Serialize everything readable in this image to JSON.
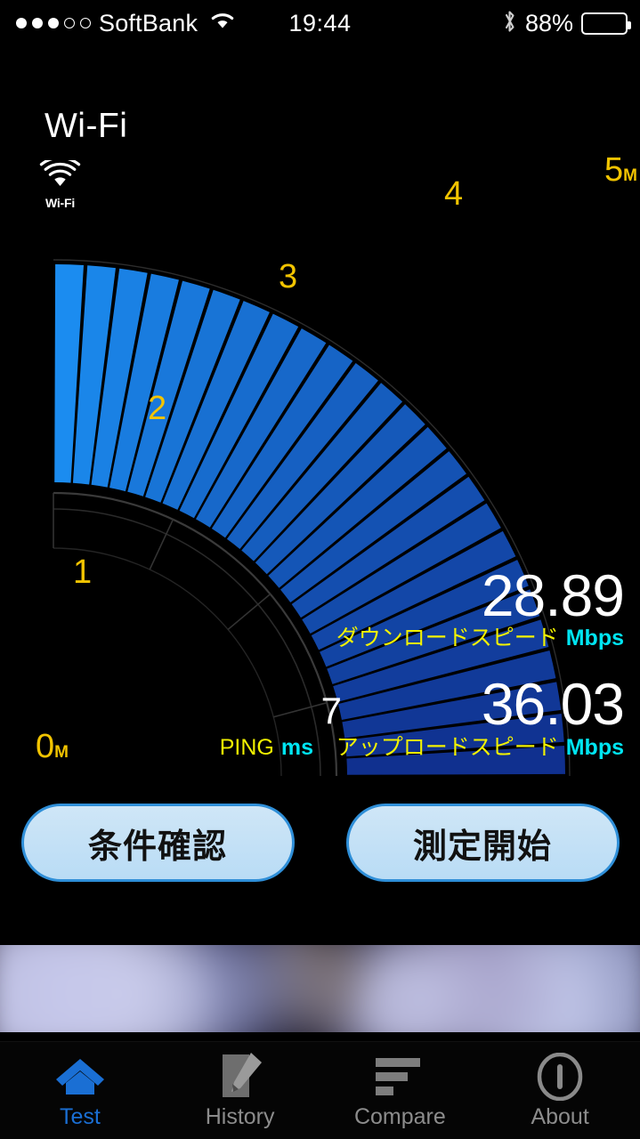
{
  "statusbar": {
    "signal_dots_filled": 3,
    "signal_dots_total": 5,
    "carrier": "SoftBank",
    "wifi_icon": "wifi-icon",
    "time": "19:44",
    "bluetooth_icon": "bluetooth-icon",
    "battery_percent": "88%",
    "battery_level": 88
  },
  "header": {
    "network_type": "Wi-Fi",
    "badge_icon": "wifi-icon",
    "badge_label": "Wi-Fi"
  },
  "gauge": {
    "unit_suffix": "M",
    "min_label": "0",
    "max_label": "5",
    "ticks": [
      "0",
      "1",
      "2",
      "3",
      "4",
      "5"
    ],
    "segments_total": 25,
    "segments_filled": 25,
    "fill_start_color": "#1b8cf0",
    "fill_end_color": "#10308f",
    "tick_color": "#f2c400"
  },
  "results": {
    "download": {
      "value": "28.89",
      "label": "ダウンロードスピード",
      "unit": "Mbps"
    },
    "upload": {
      "value": "36.03",
      "label": "アップロードスピード",
      "unit": "Mbps"
    },
    "ping": {
      "value": "7",
      "label": "PING",
      "unit": "ms"
    },
    "label_color": "#f2f200",
    "unit_color": "#00e5f2",
    "value_color": "#ffffff"
  },
  "buttons": {
    "check_conditions": "条件確認",
    "start_test": "測定開始",
    "fill_color": "#c4e2f7",
    "border_color": "#2f8fd8"
  },
  "ad_banner": {
    "name": "ad-banner",
    "state": "blurred"
  },
  "tabbar": {
    "active_color": "#1a6fd4",
    "inactive_color": "#8c8c8c",
    "items": [
      {
        "label": "Test",
        "icon": "home-icon",
        "active": true
      },
      {
        "label": "History",
        "icon": "note-pencil-icon",
        "active": false
      },
      {
        "label": "Compare",
        "icon": "bar-chart-icon",
        "active": false
      },
      {
        "label": "About",
        "icon": "info-circle-icon",
        "active": false
      }
    ]
  }
}
